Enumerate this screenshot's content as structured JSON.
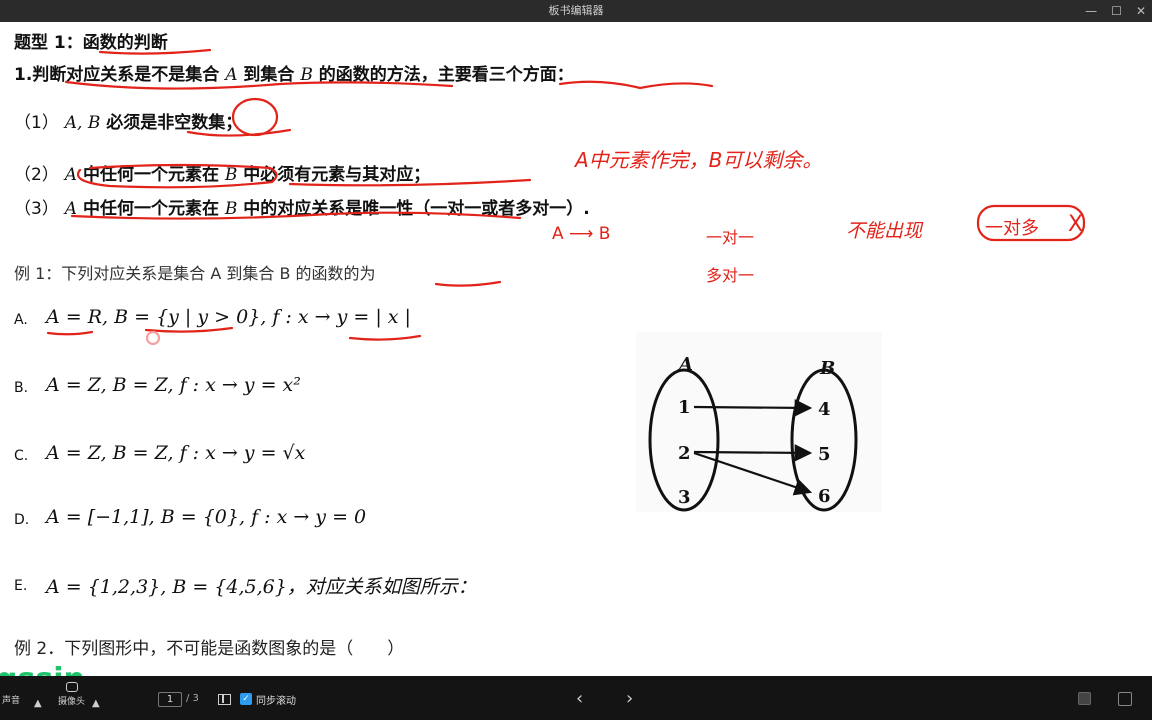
{
  "window": {
    "title": "板书编辑器"
  },
  "doc": {
    "heading": "题型 1：函数的判断",
    "p1_prefix": "1.判断对应关系是不是集合",
    "p1_A": "A",
    "p1_mid": "到集合",
    "p1_B": "B",
    "p1_suffix": "的函数的方法，主要看三个方面：",
    "c1_num": "（1）",
    "c1_ab": "A, B",
    "c1_text": "必须是非空数集；",
    "c2_num": "（2）",
    "c2_A": "A",
    "c2_mid": "中任何一个元素在",
    "c2_B": "B",
    "c2_end": "中必须有元素与其对应；",
    "c3_num": "（3）",
    "c3_A": "A",
    "c3_mid": "中任何一个元素在",
    "c3_B": "B",
    "c3_end": "中的对应关系是唯一性（一对一或者多对一）.",
    "ex1": "例 1：下列对应关系是集合 A 到集合 B 的函数的为",
    "optA_label": "A.",
    "optA": "A = R, B = {y | y > 0}, f : x → y = | x |",
    "optB_label": "B.",
    "optB": "A = Z, B = Z, f : x → y = x²",
    "optC_label": "C.",
    "optC": "A = Z, B = Z, f : x → y = √x",
    "optD_label": "D.",
    "optD": "A = [−1,1], B = {0}, f : x → y = 0",
    "optE_label": "E.",
    "optE": "A = {1,2,3}, B = {4,5,6}，对应关系如图所示：",
    "ex2": "例 2．下列图形中，不可能是函数图象的是（　　）"
  },
  "handwriting": {
    "note1": "A中元素作完，B可以剩余。",
    "note2": "A ⟶ B",
    "note3": "一对一",
    "note4": "多对一",
    "note5": "不能出现",
    "note6": "一对多",
    "note7": "X"
  },
  "diagram": {
    "setA_label": "A",
    "setB_label": "B",
    "a_items": [
      "1",
      "2",
      "3"
    ],
    "b_items": [
      "4",
      "5",
      "6"
    ]
  },
  "toolbar": {
    "sound_label": "声音",
    "camera_label": "摄像头",
    "page_current": "1",
    "page_total": "/ 3",
    "sync_label": "同步滚动",
    "logo_text": "qssin",
    "prev": "‹",
    "next": "›"
  },
  "colors": {
    "ink": "#e2231a",
    "check": "#2d9bf0",
    "logo": "#1fc36b"
  }
}
